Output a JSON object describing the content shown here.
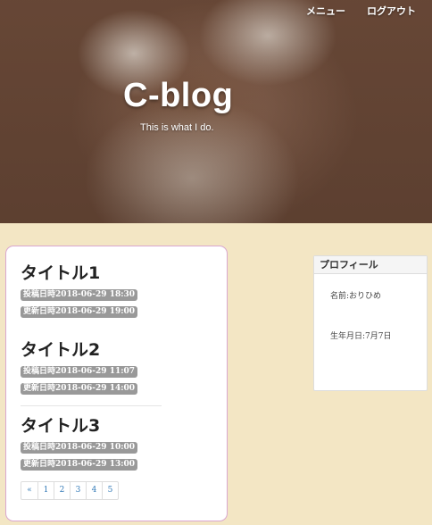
{
  "nav": {
    "menu_label": "メニュー",
    "logout_label": "ログアウト"
  },
  "site": {
    "title": "C-blog",
    "description": "This is what I do."
  },
  "posts": [
    {
      "title": "タイトル1",
      "posted": "投稿日時2018-06-29 18:30",
      "updated": "更新日時2018-06-29 19:00"
    },
    {
      "title": "タイトル2",
      "posted": "投稿日時2018-06-29 11:07",
      "updated": "更新日時2018-06-29 14:00"
    },
    {
      "title": "タイトル3",
      "posted": "投稿日時2018-06-29 10:00",
      "updated": "更新日時2018-06-29 13:00"
    }
  ],
  "pagination": {
    "prev": "«",
    "pages": [
      "1",
      "2",
      "3",
      "4",
      "5"
    ]
  },
  "profile": {
    "heading": "プロフィール",
    "name": "名前:おりひめ",
    "birthday": "生年月日:7月7日"
  },
  "colors": {
    "page_background": "#f3e6c4",
    "card_border": "#d9a6cf",
    "badge": "#999999",
    "link": "#337ab7"
  }
}
